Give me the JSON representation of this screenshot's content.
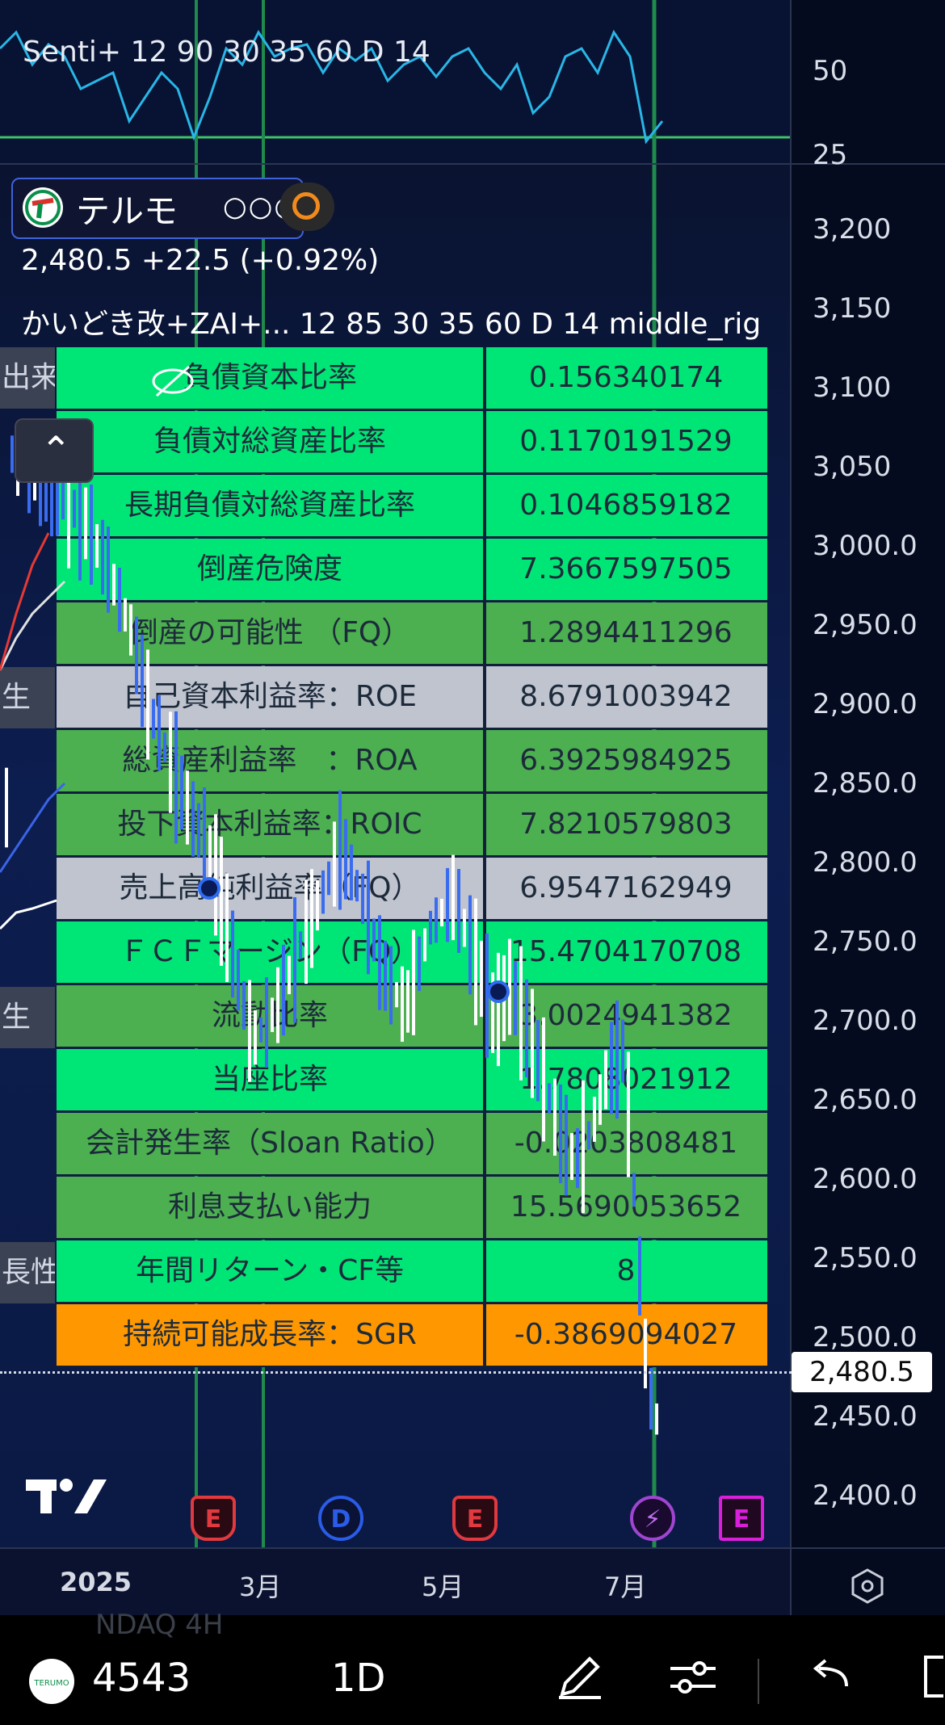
{
  "oscillator": {
    "label": "Senti+ 12 90 30 35 60 D 14",
    "scale": [
      "50",
      "25"
    ]
  },
  "symbol": {
    "name": "テルモ",
    "more": "○○○",
    "price_change": "2,480.5  +22.5 (+0.92%)",
    "indicator": "かいどき改+ZAI+...   12 85 30 35 60 D 14 middle_rig",
    "logo_icon": "terumo-logo-icon"
  },
  "price_scale": [
    "3,200",
    "3,150",
    "3,100",
    "3,050",
    "3,000.0",
    "2,950.0",
    "2,900.0",
    "2,850.0",
    "2,800.0",
    "2,750.0",
    "2,700.0",
    "2,650.0",
    "2,600.0",
    "2,550.0",
    "2,500.0",
    "2,450.0",
    "2,400.0"
  ],
  "last_price": "2,480.5",
  "side_labels": [
    "出来高",
    "生",
    "生",
    "長性"
  ],
  "metrics": [
    {
      "label": "負債資本比率",
      "value": "0.156340174",
      "color": "#00e676"
    },
    {
      "label": "負債対総資産比率",
      "value": "0.1170191529",
      "color": "#00e676"
    },
    {
      "label": "長期負債対総資産比率",
      "value": "0.1046859182",
      "color": "#00e676"
    },
    {
      "label": "倒産危険度",
      "value": "7.3667597505",
      "color": "#00e676"
    },
    {
      "label": "倒産の可能性 （FQ）",
      "value": "1.2894411296",
      "color": "#4caf50"
    },
    {
      "label": "自己資本利益率：ROE",
      "value": "8.6791003942",
      "color": "#c0c4cf"
    },
    {
      "label": "総資産利益率　：ROA",
      "value": "6.3925984925",
      "color": "#4caf50"
    },
    {
      "label": "投下資本利益率：ROIC",
      "value": "7.8210579803",
      "color": "#4caf50"
    },
    {
      "label": "売上高純利益率（FQ）",
      "value": "6.9547162949",
      "color": "#c0c4cf"
    },
    {
      "label": "ＦＣＦマージン（FQ）",
      "value": "15.4704170708",
      "color": "#00e676"
    },
    {
      "label": "流動比率",
      "value": "3.0024941382",
      "color": "#4caf50"
    },
    {
      "label": "当座比率",
      "value": "1.7808021912",
      "color": "#00e676"
    },
    {
      "label": "会計発生率（Sloan Ratio）",
      "value": "-0.0203808481",
      "color": "#4caf50"
    },
    {
      "label": "利息支払い能力",
      "value": "15.5690053652",
      "color": "#4caf50"
    },
    {
      "label": "年間リターン・CF等",
      "value": "8",
      "color": "#00e676"
    },
    {
      "label": "持続可能成長率：SGR",
      "value": "-0.3869094027",
      "color": "#ff9800"
    }
  ],
  "events": [
    {
      "type": "E",
      "icon": "earnings-icon"
    },
    {
      "type": "D",
      "icon": "dividend-icon"
    },
    {
      "type": "E",
      "icon": "earnings-icon"
    },
    {
      "type": "⚡",
      "icon": "flash-icon"
    },
    {
      "type": "E",
      "icon": "earnings-icon"
    }
  ],
  "time_axis": [
    "2025",
    "3月",
    "5月",
    "7月"
  ],
  "toolbar": {
    "ghost_text": "NDAQ          4H",
    "symbol": "4543",
    "interval": "1D",
    "icons": [
      "pen-icon",
      "sliders-icon",
      "undo-icon"
    ]
  },
  "tv_logo": "17"
}
